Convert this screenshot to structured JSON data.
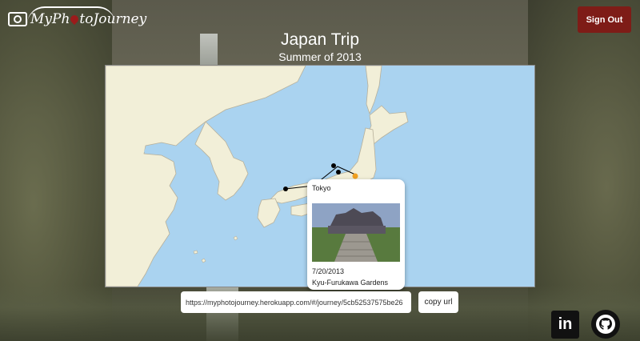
{
  "brand": {
    "logo_text_before": "MyPh",
    "logo_text_after": "toJourney"
  },
  "header": {
    "signout_label": "Sign Out"
  },
  "journey": {
    "title": "Japan Trip",
    "subtitle": "Summer of 2013"
  },
  "popup": {
    "city": "Tokyo",
    "date": "7/20/2013",
    "place": "Kyu-Furukawa Gardens"
  },
  "share": {
    "url": "https://myphotojourney.herokuapp.com/#/journey/5cb52537575be26",
    "copy_label": "copy url"
  },
  "footer": {
    "linkedin_icon": "linkedin-icon",
    "github_icon": "github-icon"
  },
  "colors": {
    "signout": "#7e1c17",
    "sea": "#aad3f0",
    "land": "#f2efd8",
    "route": "#000000",
    "marker_highlight": "#f0a020"
  }
}
